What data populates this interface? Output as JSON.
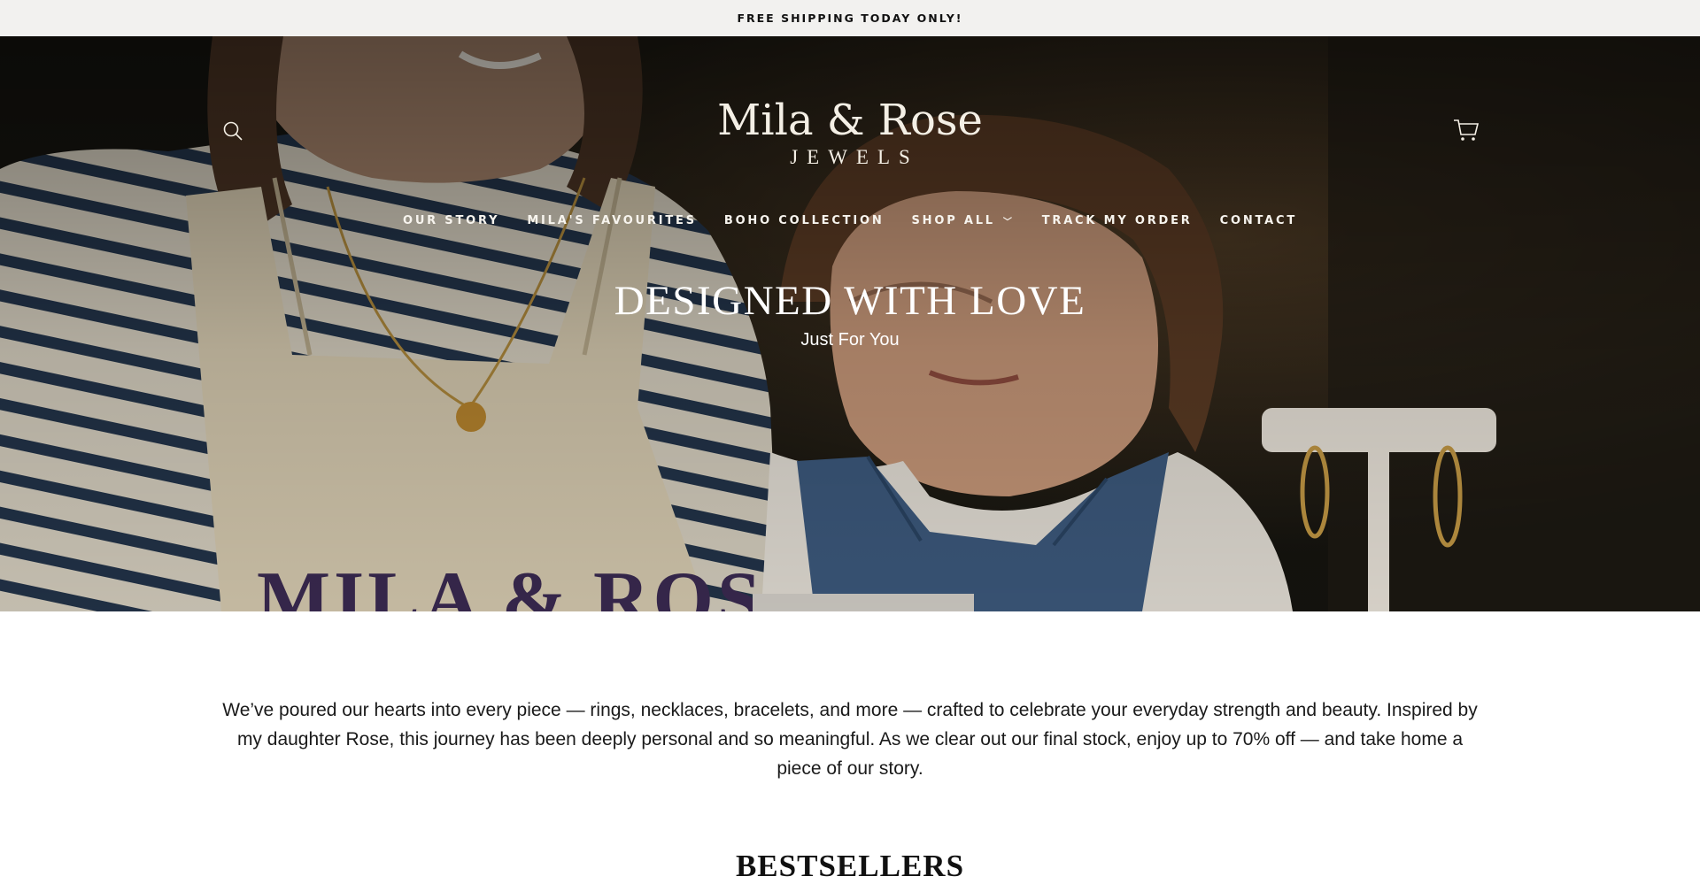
{
  "announcement": {
    "text": "FREE SHIPPING TODAY ONLY!"
  },
  "header": {
    "search_icon": "search-icon",
    "cart_icon": "cart-icon",
    "logo": {
      "main": "Mila & Rose",
      "sub": "JEWELS"
    }
  },
  "nav": {
    "items": [
      {
        "label": "OUR STORY"
      },
      {
        "label": "MILA'S FAVOURITES"
      },
      {
        "label": "BOHO COLLECTION"
      },
      {
        "label": "SHOP ALL",
        "has_dropdown": true
      },
      {
        "label": "TRACK MY ORDER"
      },
      {
        "label": "CONTACT"
      }
    ]
  },
  "hero": {
    "title": "DESIGNED WITH LOVE",
    "subtitle": "Just For You",
    "apron_text": "MILA & ROSE"
  },
  "intro": {
    "text": "We’ve poured our hearts into every piece — rings, necklaces, bracelets, and more — crafted to celebrate your everyday strength and beauty. Inspired by my daughter Rose, this journey has been deeply personal and so meaningful. As we clear out our final stock, enjoy up to 70% off — and take home a piece of our story."
  },
  "bestsellers": {
    "title": "BESTSELLERS"
  }
}
